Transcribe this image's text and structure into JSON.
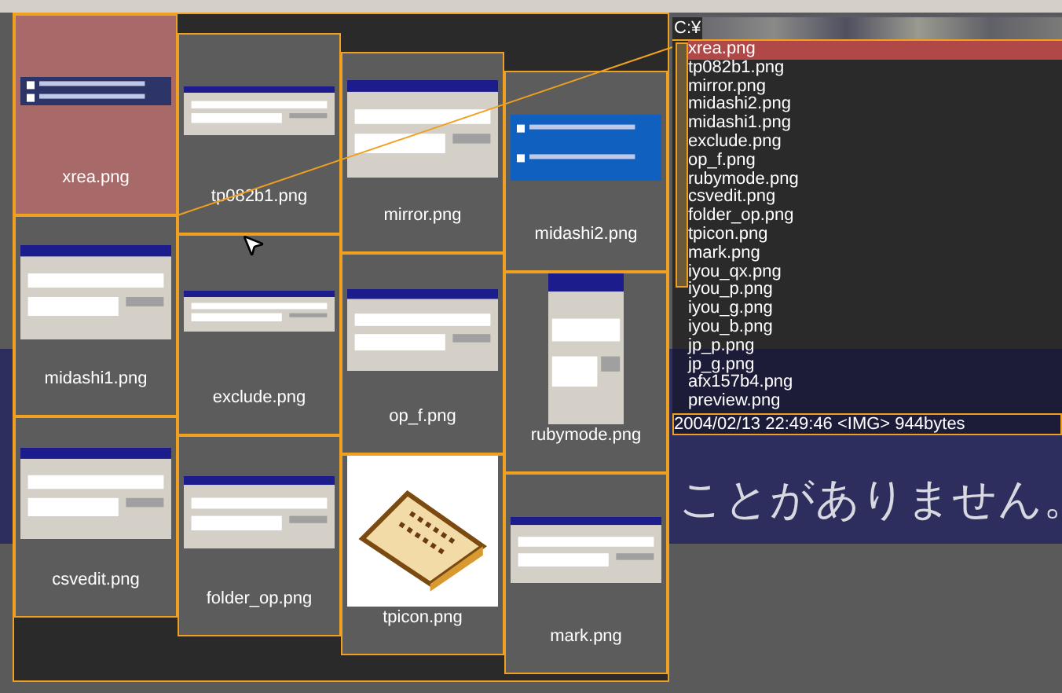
{
  "thumbnail_columns": [
    {
      "cells": [
        {
          "name": "xrea.png",
          "selected": true
        },
        {
          "name": "midashi1.png",
          "selected": false
        },
        {
          "name": "csvedit.png",
          "selected": false
        }
      ]
    },
    {
      "cells": [
        {
          "name": "tp082b1.png",
          "selected": false
        },
        {
          "name": "exclude.png",
          "selected": false
        },
        {
          "name": "folder_op.png",
          "selected": false
        }
      ]
    },
    {
      "cells": [
        {
          "name": "mirror.png",
          "selected": false
        },
        {
          "name": "op_f.png",
          "selected": false
        },
        {
          "name": "tpicon.png",
          "selected": false
        }
      ]
    },
    {
      "cells": [
        {
          "name": "midashi2.png",
          "selected": false
        },
        {
          "name": "rubymode.png",
          "selected": false
        },
        {
          "name": "mark.png",
          "selected": false
        }
      ]
    }
  ],
  "path": "C:¥",
  "files": [
    {
      "name": "xrea.png",
      "selected": true
    },
    {
      "name": "tp082b1.png",
      "selected": false
    },
    {
      "name": "mirror.png",
      "selected": false
    },
    {
      "name": "midashi2.png",
      "selected": false
    },
    {
      "name": "midashi1.png",
      "selected": false
    },
    {
      "name": "exclude.png",
      "selected": false
    },
    {
      "name": "op_f.png",
      "selected": false
    },
    {
      "name": "rubymode.png",
      "selected": false
    },
    {
      "name": "csvedit.png",
      "selected": false
    },
    {
      "name": "folder_op.png",
      "selected": false
    },
    {
      "name": "tpicon.png",
      "selected": false
    },
    {
      "name": "mark.png",
      "selected": false
    },
    {
      "name": "iyou_qx.png",
      "selected": false
    },
    {
      "name": "iyou_p.png",
      "selected": false
    },
    {
      "name": "iyou_g.png",
      "selected": false
    },
    {
      "name": "iyou_b.png",
      "selected": false
    },
    {
      "name": "jp_p.png",
      "selected": false
    },
    {
      "name": "jp_g.png",
      "selected": false
    },
    {
      "name": "afx157b4.png",
      "selected": false
    },
    {
      "name": "preview.png",
      "selected": false
    }
  ],
  "status": "2004/02/13 22:49:46 <IMG> 944bytes",
  "preview_text": "ことがありません。"
}
